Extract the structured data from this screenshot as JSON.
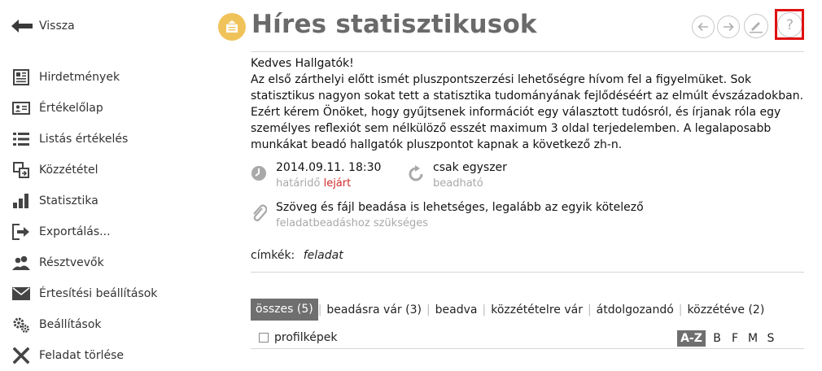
{
  "nav": {
    "back_label": "Vissza"
  },
  "sidebar": {
    "items": [
      {
        "label": "Hirdetmények",
        "icon": "announcements-icon"
      },
      {
        "label": "Értékelőlap",
        "icon": "id-card-icon"
      },
      {
        "label": "Listás értékelés",
        "icon": "list-icon"
      },
      {
        "label": "Közzététel",
        "icon": "publish-icon"
      },
      {
        "label": "Statisztika",
        "icon": "bar-chart-icon"
      },
      {
        "label": "Exportálás...",
        "icon": "export-icon"
      },
      {
        "label": "Résztvevők",
        "icon": "users-icon"
      },
      {
        "label": "Értesítési beállítások",
        "icon": "envelope-icon"
      },
      {
        "label": "Beállítások",
        "icon": "gears-icon"
      },
      {
        "label": "Feladat törlése",
        "icon": "delete-icon"
      }
    ]
  },
  "header": {
    "title": "Híres statisztikusok",
    "icon": "task-icon",
    "buttons": [
      "prev-icon",
      "next-icon",
      "edit-icon",
      "help-icon"
    ],
    "help_label": "?",
    "accent_color": "#f0c35a",
    "highlight_color": "#e01010"
  },
  "assignment": {
    "description": [
      "Kedves Hallgatók!",
      "Az első zárthelyi előtt ismét pluszpontszerzési lehetőségre hívom fel a figyelmüket. Sok statisztikus nagyon sokat tett a statisztika tudományának fejlődéséért az elmúlt évszázadokban. Ezért kérem Önöket, hogy gyűjtsenek információt egy választott tudósról, és írjanak róla egy személyes reflexiót sem nélkülöző esszét maximum 3 oldal terjedelemben. A legalaposabb munkákat beadó hallgatók pluszpontot kapnak a következő zh-n."
    ],
    "deadline": {
      "value": "2014.09.11. 18:30",
      "label": "határidő",
      "status": "lejárt"
    },
    "submission": {
      "value": "csak egyszer",
      "label": "beadható"
    },
    "requirement": {
      "value": "Szöveg és fájl beadása is lehetséges, legalább az egyik kötelező",
      "label": "feladatbeadáshoz szükséges"
    },
    "tags": {
      "label": "címkék:",
      "value": "feladat"
    }
  },
  "filters": [
    {
      "label": "összes (5)",
      "active": true
    },
    {
      "label": "beadásra vár (3)",
      "active": false
    },
    {
      "label": "beadva",
      "active": false
    },
    {
      "label": "közzétételre vár",
      "active": false
    },
    {
      "label": "átdolgozandó",
      "active": false
    },
    {
      "label": "közzétéve (2)",
      "active": false
    }
  ],
  "options": {
    "profile_images_label": "profilképek",
    "sort": [
      "A-Z",
      "B",
      "F",
      "M",
      "S"
    ],
    "sort_active": "A-Z"
  }
}
